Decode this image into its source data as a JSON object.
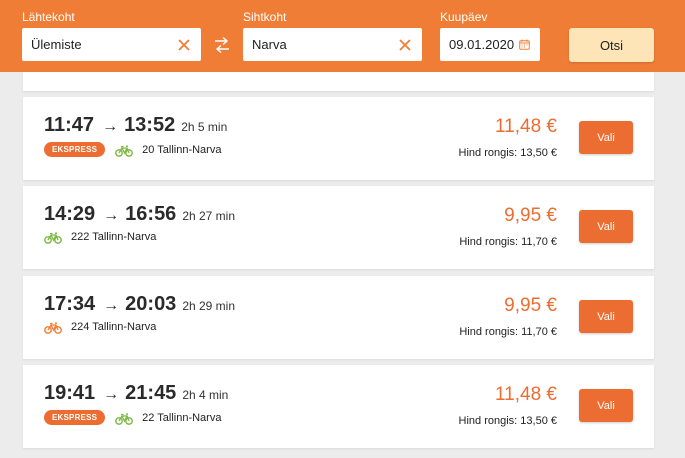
{
  "search": {
    "from_label": "Lähtekoht",
    "from_value": "Ülemiste",
    "to_label": "Sihtkoht",
    "to_value": "Narva",
    "date_label": "Kuupäev",
    "date_value": "09.01.2020",
    "search_button": "Otsi"
  },
  "trips": [
    {
      "depart": "11:47",
      "arrive": "13:52",
      "duration": "2h 5 min",
      "badge": "EKSPRESS",
      "bike_icon": "bicycle-icon",
      "bike_color": "#7ab843",
      "route": "20 Tallinn-Narva",
      "price": "11,48 €",
      "train_price": "Hind rongis: 13,50 €",
      "select": "Vali"
    },
    {
      "depart": "14:29",
      "arrive": "16:56",
      "duration": "2h 27 min",
      "badge": "",
      "bike_icon": "bicycle-icon",
      "bike_color": "#7ab843",
      "route": "222 Tallinn-Narva",
      "price": "9,95 €",
      "train_price": "Hind rongis: 11,70 €",
      "select": "Vali"
    },
    {
      "depart": "17:34",
      "arrive": "20:03",
      "duration": "2h 29 min",
      "badge": "",
      "bike_icon": "bicycle-icon",
      "bike_color": "#ef7d35",
      "route": "224 Tallinn-Narva",
      "price": "9,95 €",
      "train_price": "Hind rongis: 11,70 €",
      "select": "Vali"
    },
    {
      "depart": "19:41",
      "arrive": "21:45",
      "duration": "2h 4 min",
      "badge": "EKSPRESS",
      "bike_icon": "bicycle-icon",
      "bike_color": "#7ab843",
      "route": "22 Tallinn-Narva",
      "price": "11,48 €",
      "train_price": "Hind rongis: 13,50 €",
      "select": "Vali"
    }
  ],
  "colors": {
    "accent": "#ef7d35",
    "price": "#ec6d31",
    "bike_green": "#7ab843"
  }
}
